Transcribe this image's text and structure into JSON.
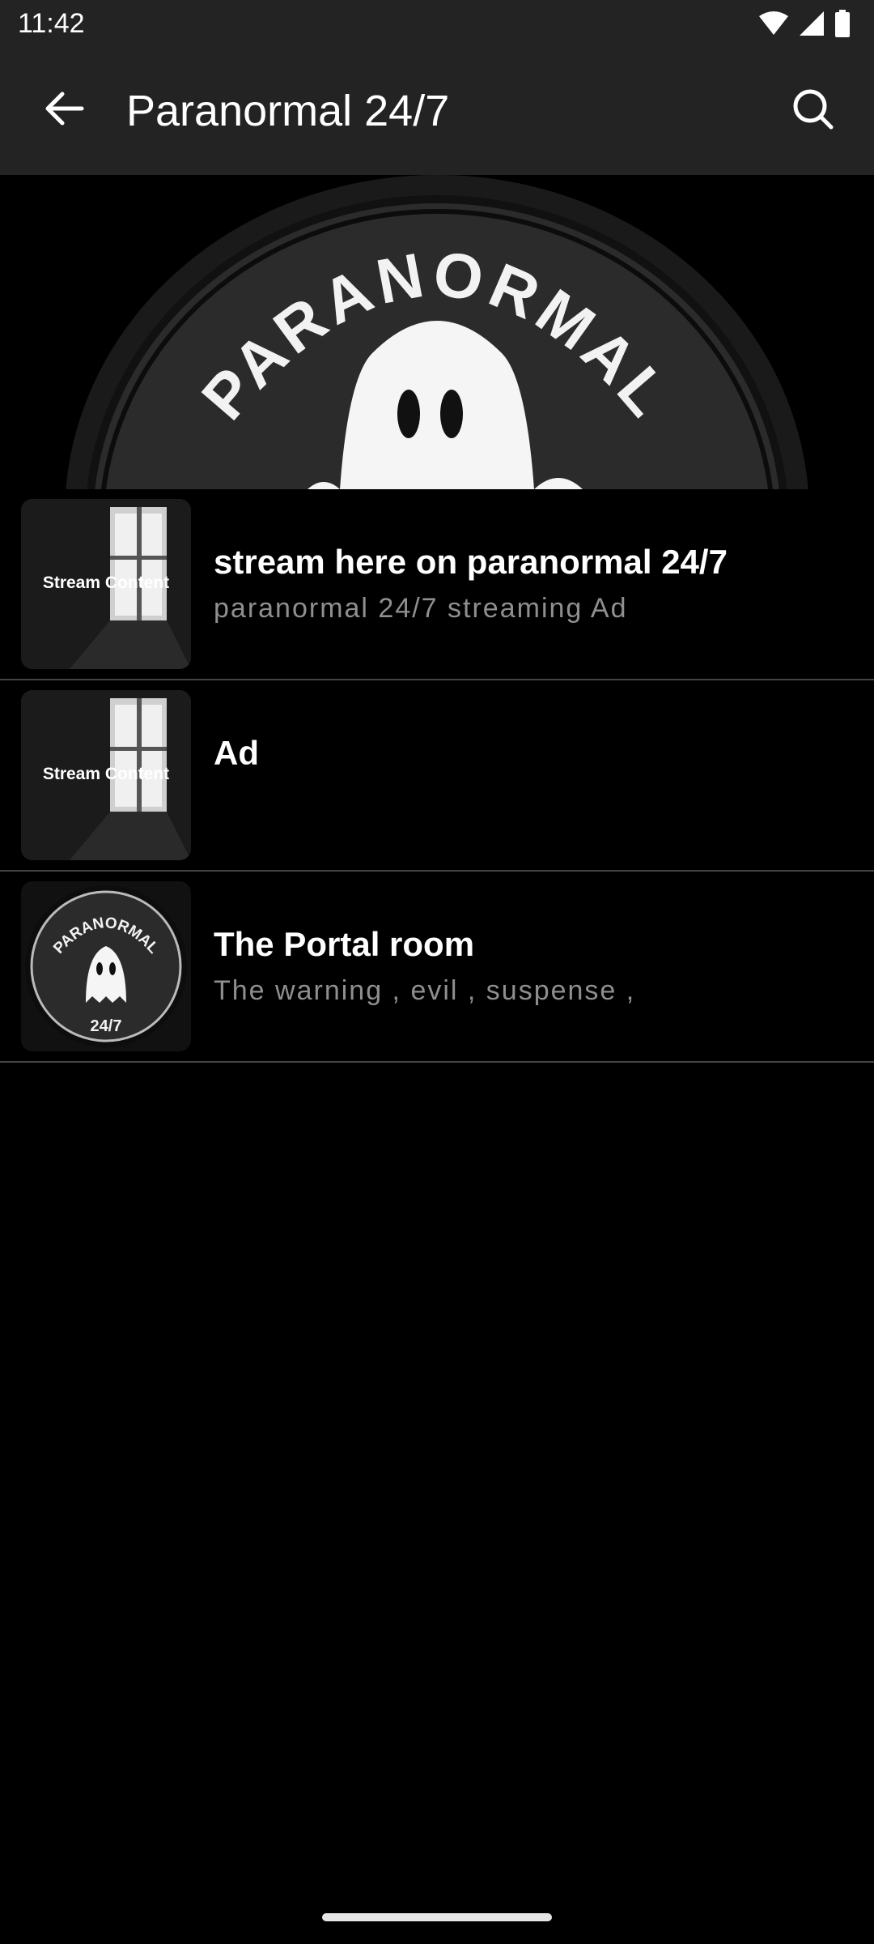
{
  "status_bar": {
    "time": "11:42"
  },
  "app_bar": {
    "title": "Paranormal 24/7"
  },
  "banner": {
    "text": "PARANORMAL"
  },
  "episodes": [
    {
      "thumb_label": "Stream Content",
      "title": "stream here on paranormal 24/7",
      "subtitle": "paranormal 24/7 streaming Ad"
    },
    {
      "thumb_label": "Stream Content",
      "title": "Ad",
      "subtitle": ""
    },
    {
      "thumb_label": "",
      "title": "The Portal room",
      "subtitle": "The warning , evil , suspense ,"
    }
  ],
  "logo_thumb": {
    "top_text": "PARANORMAL",
    "bottom_text": "24/7"
  }
}
